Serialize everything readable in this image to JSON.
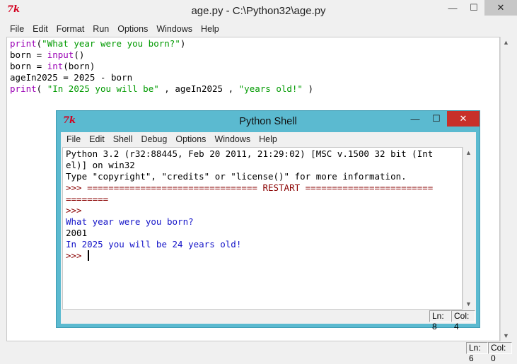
{
  "editor": {
    "title": "age.py - C:\\Python32\\age.py",
    "icon_text": "7k",
    "buttons": {
      "minimize": "—",
      "maximize": "☐",
      "close": "✕"
    },
    "menu": [
      "File",
      "Edit",
      "Format",
      "Run",
      "Options",
      "Windows",
      "Help"
    ],
    "code": [
      [
        {
          "t": "print",
          "c": "kw"
        },
        {
          "t": "(",
          "c": "blk"
        },
        {
          "t": "\"What year were you born?\"",
          "c": "str"
        },
        {
          "t": ")",
          "c": "blk"
        }
      ],
      [
        {
          "t": "born = ",
          "c": "blk"
        },
        {
          "t": "input",
          "c": "kw"
        },
        {
          "t": "()",
          "c": "blk"
        }
      ],
      [
        {
          "t": "born = ",
          "c": "blk"
        },
        {
          "t": "int",
          "c": "kw"
        },
        {
          "t": "(born)",
          "c": "blk"
        }
      ],
      [
        {
          "t": "ageIn2025 = 2025 - born",
          "c": "blk"
        }
      ],
      [
        {
          "t": "print",
          "c": "kw"
        },
        {
          "t": "( ",
          "c": "blk"
        },
        {
          "t": "\"In 2025 you will be\"",
          "c": "str"
        },
        {
          "t": " , ageIn2025 , ",
          "c": "blk"
        },
        {
          "t": "\"years old!\"",
          "c": "str"
        },
        {
          "t": " )",
          "c": "blk"
        }
      ]
    ],
    "status": {
      "line": "Ln: 6",
      "col": "Col: 0"
    }
  },
  "shell": {
    "title": "Python Shell",
    "icon_text": "7k",
    "buttons": {
      "minimize": "—",
      "maximize": "☐",
      "close": "✕"
    },
    "menu": [
      "File",
      "Edit",
      "Shell",
      "Debug",
      "Options",
      "Windows",
      "Help"
    ],
    "lines": [
      {
        "t": "Python 3.2 (r32:88445, Feb 20 2011, 21:29:02) [MSC v.1500 32 bit (Int",
        "c": "blk"
      },
      {
        "t": "el)] on win32",
        "c": "blk"
      },
      {
        "t": "Type \"copyright\", \"credits\" or \"license()\" for more information.",
        "c": "blk"
      },
      {
        "t": ">>> ================================ RESTART ========================",
        "c": "prompt"
      },
      {
        "t": "========",
        "c": "prompt"
      },
      {
        "t": ">>> ",
        "c": "prompt"
      },
      {
        "t": "What year were you born?",
        "c": "out"
      },
      {
        "t": "2001",
        "c": "blk"
      },
      {
        "t": "In 2025 you will be 24 years old!",
        "c": "out"
      },
      {
        "t": ">>> ",
        "c": "prompt",
        "cursor": true
      }
    ],
    "status": {
      "line": "Ln: 8",
      "col": "Col: 4"
    }
  }
}
